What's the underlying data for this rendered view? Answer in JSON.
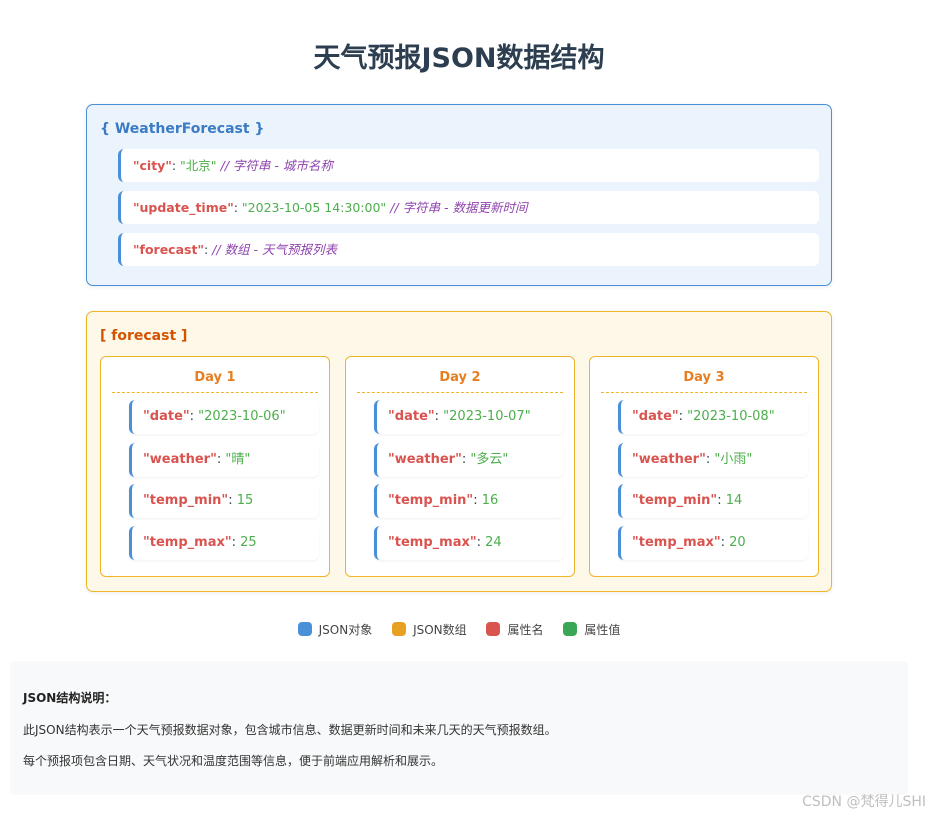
{
  "title": "天气预报JSON数据结构",
  "object": {
    "header": "{ WeatherForecast }",
    "props": [
      {
        "key": "\"city\"",
        "value": "\"北京\"",
        "comment": "// 字符串 - 城市名称"
      },
      {
        "key": "\"update_time\"",
        "value": "\"2023-10-05 14:30:00\"",
        "comment": "// 字符串 - 数据更新时间"
      },
      {
        "key": "\"forecast\"",
        "value": "",
        "comment": "// 数组 - 天气预报列表"
      }
    ]
  },
  "array": {
    "header": "[ forecast ]",
    "days": [
      {
        "label": "Day 1",
        "props": [
          {
            "key": "\"date\"",
            "value": "\"2023-10-06\""
          },
          {
            "key": "\"weather\"",
            "value": "\"晴\""
          },
          {
            "key": "\"temp_min\"",
            "value": "15"
          },
          {
            "key": "\"temp_max\"",
            "value": "25"
          }
        ]
      },
      {
        "label": "Day 2",
        "props": [
          {
            "key": "\"date\"",
            "value": "\"2023-10-07\""
          },
          {
            "key": "\"weather\"",
            "value": "\"多云\""
          },
          {
            "key": "\"temp_min\"",
            "value": "16"
          },
          {
            "key": "\"temp_max\"",
            "value": "24"
          }
        ]
      },
      {
        "label": "Day 3",
        "props": [
          {
            "key": "\"date\"",
            "value": "\"2023-10-08\""
          },
          {
            "key": "\"weather\"",
            "value": "\"小雨\""
          },
          {
            "key": "\"temp_min\"",
            "value": "14"
          },
          {
            "key": "\"temp_max\"",
            "value": "20"
          }
        ]
      }
    ]
  },
  "legend": [
    {
      "label": "JSON对象",
      "color": "#4a90d9"
    },
    {
      "label": "JSON数组",
      "color": "#e8a020"
    },
    {
      "label": "属性名",
      "color": "#d9534f"
    },
    {
      "label": "属性值",
      "color": "#3aa757"
    }
  ],
  "description": {
    "title": "JSON结构说明：",
    "lines": [
      "此JSON结构表示一个天气预报数据对象，包含城市信息、数据更新时间和未来几天的天气预报数组。",
      "每个预报项包含日期、天气状况和温度范围等信息，便于前端应用解析和展示。"
    ]
  },
  "watermark": "CSDN @梵得儿SHI"
}
